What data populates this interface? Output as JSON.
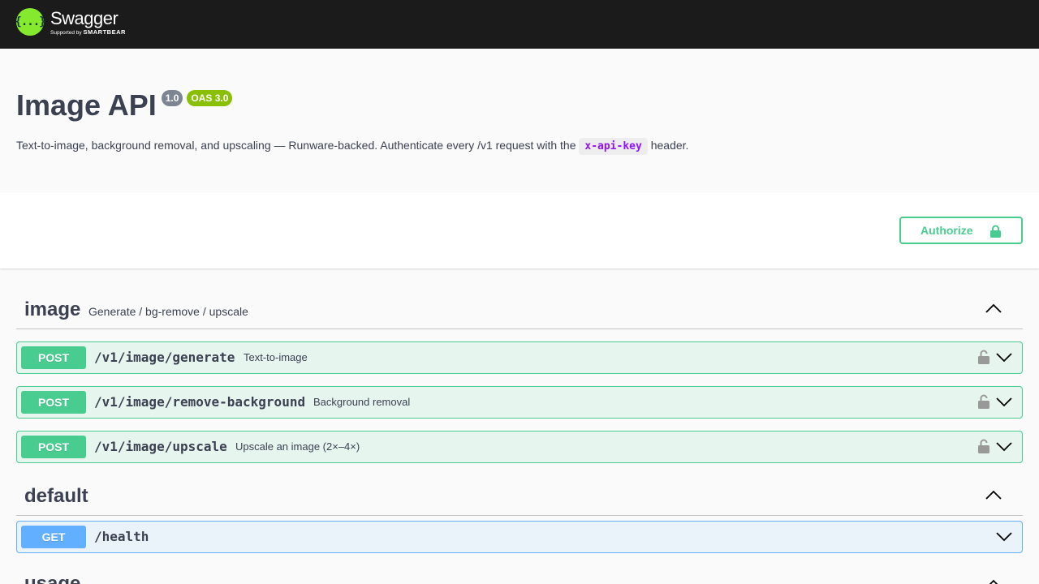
{
  "topbar": {
    "logo_mark": "{...}",
    "brand": "Swagger",
    "supported_by": "Supported by",
    "sponsor": "SMARTBEAR"
  },
  "info": {
    "title": "Image API",
    "version": "1.0",
    "oas": "OAS 3.0",
    "description_before": "Text-to-image, background removal, and upscaling — Runware-backed. Authenticate every /v1 request with the ",
    "description_code": "x-api-key",
    "description_after": " header."
  },
  "authorize": {
    "label": "Authorize",
    "icon": "lock-icon"
  },
  "tags": [
    {
      "name": "image",
      "description": "Generate / bg-remove / upscale",
      "expanded": true,
      "operations": [
        {
          "method": "POST",
          "path": "/v1/image/generate",
          "summary": "Text-to-image",
          "locked": true
        },
        {
          "method": "POST",
          "path": "/v1/image/remove-background",
          "summary": "Background removal",
          "locked": true
        },
        {
          "method": "POST",
          "path": "/v1/image/upscale",
          "summary": "Upscale an image (2×–4×)",
          "locked": true
        }
      ]
    },
    {
      "name": "default",
      "description": "",
      "expanded": true,
      "operations": [
        {
          "method": "GET",
          "path": "/health",
          "summary": "",
          "locked": false
        }
      ]
    },
    {
      "name": "usage",
      "description": "",
      "expanded": true,
      "operations": []
    }
  ],
  "colors": {
    "topbar": "#1b1b1b",
    "logo_green": "#85ea2d",
    "post": "#49cc90",
    "get": "#61affe",
    "version_badge": "#7d8492",
    "oas_badge": "#89bf04",
    "code_text": "#9012fe"
  }
}
